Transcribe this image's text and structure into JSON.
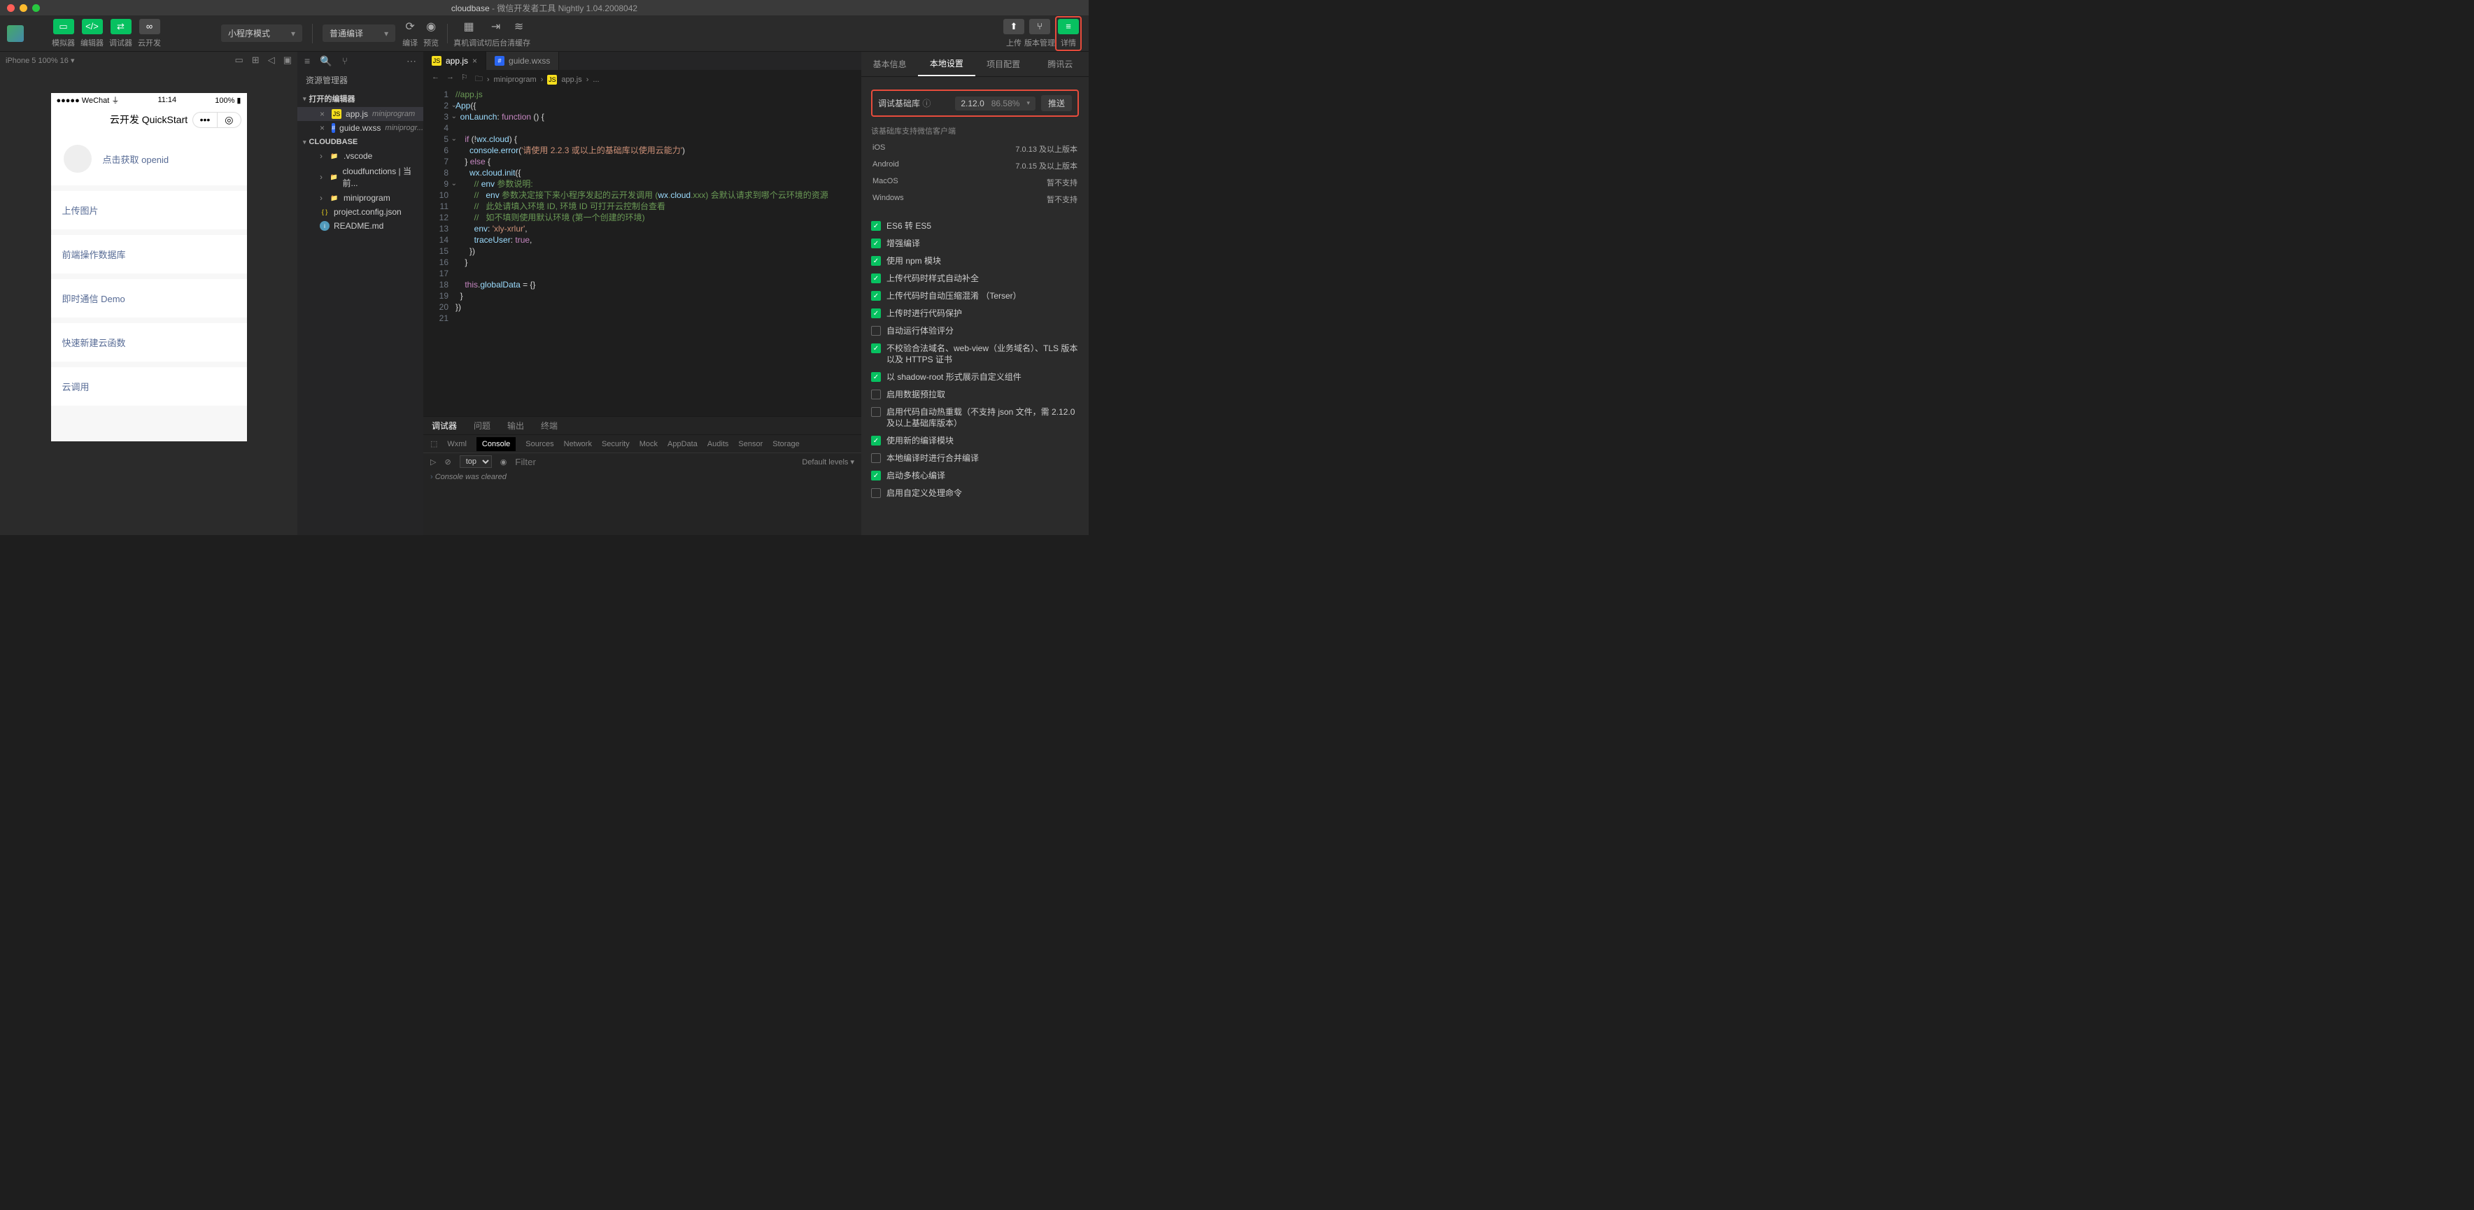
{
  "titlebar": {
    "project": "cloudbase",
    "app": "微信开发者工具 Nightly 1.04.2008042"
  },
  "toolbar": {
    "simulator": "模拟器",
    "editor": "编辑器",
    "debugger": "调试器",
    "cloud": "云开发",
    "mode": "小程序模式",
    "compile": "普通编译",
    "compile_btn": "编译",
    "preview": "预览",
    "remote": "真机调试",
    "background": "切后台",
    "cache": "清缓存",
    "upload": "上传",
    "version": "版本管理",
    "details": "详情"
  },
  "sim": {
    "device": "iPhone 5 100% 16",
    "carrier": "WeChat",
    "time": "11:14",
    "battery": "100%",
    "title": "云开发 QuickStart",
    "openid": "点击获取 openid",
    "items": [
      "上传图片",
      "前端操作数据库",
      "即时通信 Demo",
      "快速新建云函数",
      "云调用"
    ]
  },
  "explorer": {
    "title": "资源管理器",
    "open_editors": "打开的编辑器",
    "open_files": [
      {
        "name": "app.js",
        "dir": "miniprogram",
        "type": "js"
      },
      {
        "name": "guide.wxss",
        "dir": "miniprogr...",
        "type": "css"
      }
    ],
    "root": "CLOUDBASE",
    "tree": [
      {
        "name": ".vscode",
        "type": "folder",
        "chev": true
      },
      {
        "name": "cloudfunctions | 当前...",
        "type": "folder",
        "chev": true
      },
      {
        "name": "miniprogram",
        "type": "folder",
        "chev": true
      },
      {
        "name": "project.config.json",
        "type": "json"
      },
      {
        "name": "README.md",
        "type": "md"
      }
    ]
  },
  "editor": {
    "tabs": [
      {
        "name": "app.js",
        "type": "js",
        "active": true
      },
      {
        "name": "guide.wxss",
        "type": "css",
        "active": false
      }
    ],
    "breadcrumb": [
      "miniprogram",
      "app.js",
      "..."
    ],
    "lines": [
      "//app.js",
      "App({",
      "  onLaunch: function () {",
      "",
      "    if (!wx.cloud) {",
      "      console.error('请使用 2.2.3 或以上的基础库以使用云能力')",
      "    } else {",
      "      wx.cloud.init({",
      "        // env 参数说明:",
      "        //   env 参数决定接下来小程序发起的云开发调用 (wx.cloud.xxx) 会默认请求到哪个云环境的资源",
      "        //   此处请填入环境 ID, 环境 ID 可打开云控制台查看",
      "        //   如不填则使用默认环境 (第一个创建的环境)",
      "        env: 'xly-xrlur',",
      "        traceUser: true,",
      "      })",
      "    }",
      "",
      "    this.globalData = {}",
      "  }",
      "})",
      ""
    ]
  },
  "debugger": {
    "tabs": [
      "调试器",
      "问题",
      "输出",
      "终端"
    ],
    "tools": [
      "Wxml",
      "Console",
      "Sources",
      "Network",
      "Security",
      "Mock",
      "AppData",
      "Audits",
      "Sensor",
      "Storage"
    ],
    "scope": "top",
    "filter_ph": "Filter",
    "levels": "Default levels",
    "message": "Console was cleared"
  },
  "rpanel": {
    "tabs": [
      "基本信息",
      "本地设置",
      "项目配置",
      "腾讯云"
    ],
    "lib_label": "调试基础库",
    "lib_ver": "2.12.0",
    "lib_pct": "86.58%",
    "push": "推送",
    "support_head": "该基础库支持微信客户端",
    "support": [
      {
        "k": "iOS",
        "v": "7.0.13 及以上版本"
      },
      {
        "k": "Android",
        "v": "7.0.15 及以上版本"
      },
      {
        "k": "MacOS",
        "v": "暂不支持"
      },
      {
        "k": "Windows",
        "v": "暂不支持"
      }
    ],
    "checks": [
      {
        "on": true,
        "label": "ES6 转 ES5"
      },
      {
        "on": true,
        "label": "增强编译"
      },
      {
        "on": true,
        "label": "使用 npm 模块"
      },
      {
        "on": true,
        "label": "上传代码时样式自动补全"
      },
      {
        "on": true,
        "label": "上传代码时自动压缩混淆 （Terser）"
      },
      {
        "on": true,
        "label": "上传时进行代码保护"
      },
      {
        "on": false,
        "label": "自动运行体验评分"
      },
      {
        "on": true,
        "label": "不校验合法域名、web-view（业务域名）、TLS 版本以及 HTTPS 证书"
      },
      {
        "on": true,
        "label": "以 shadow-root 形式展示自定义组件"
      },
      {
        "on": false,
        "label": "启用数据预拉取"
      },
      {
        "on": false,
        "label": "启用代码自动热重载（不支持 json 文件，需 2.12.0 及以上基础库版本）"
      },
      {
        "on": true,
        "label": "使用新的编译模块"
      },
      {
        "on": false,
        "label": "本地编译时进行合并编译"
      },
      {
        "on": true,
        "label": "启动多核心编译"
      },
      {
        "on": false,
        "label": "启用自定义处理命令"
      }
    ]
  }
}
